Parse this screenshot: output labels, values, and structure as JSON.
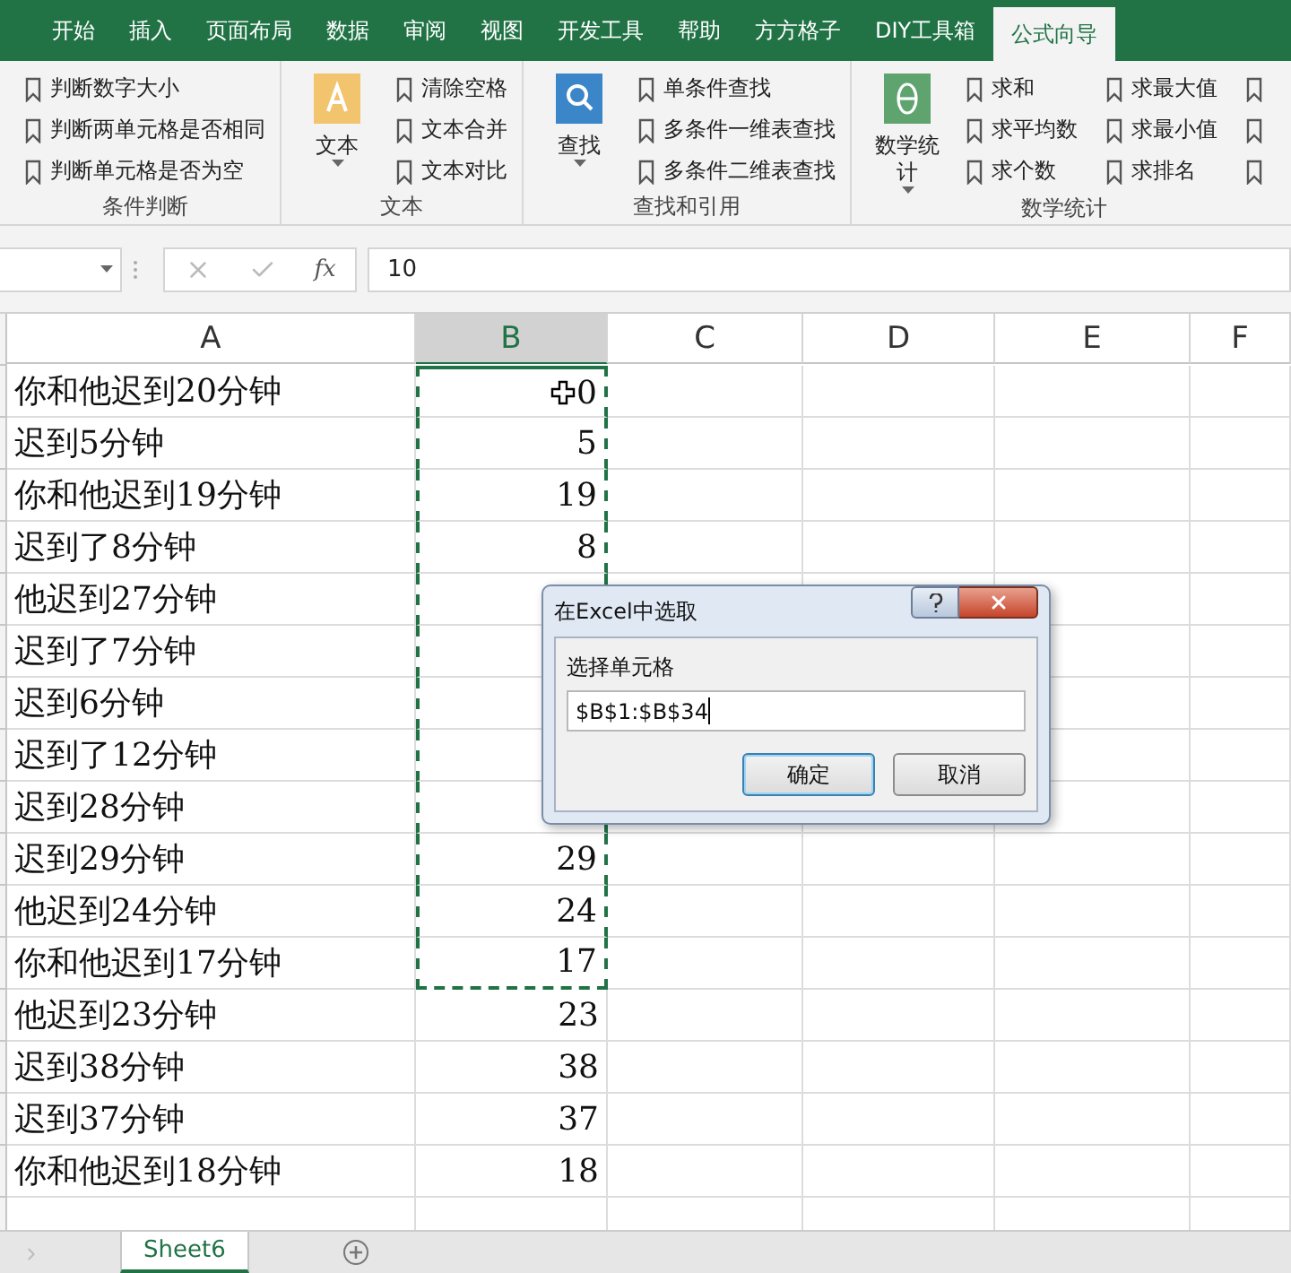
{
  "ribbon_tabs": [
    {
      "label": "开始",
      "selected": false
    },
    {
      "label": "插入",
      "selected": false
    },
    {
      "label": "页面布局",
      "selected": false
    },
    {
      "label": "数据",
      "selected": false
    },
    {
      "label": "审阅",
      "selected": false
    },
    {
      "label": "视图",
      "selected": false
    },
    {
      "label": "开发工具",
      "selected": false
    },
    {
      "label": "帮助",
      "selected": false
    },
    {
      "label": "方方格子",
      "selected": false
    },
    {
      "label": "DIY工具箱",
      "selected": false
    },
    {
      "label": "公式向导",
      "selected": true
    }
  ],
  "ribbon_groups": [
    {
      "label": "条件判断",
      "items": [
        "判断数字大小",
        "判断两单元格是否相同",
        "判断单元格是否为空"
      ]
    },
    {
      "label": "文本",
      "big_button": {
        "label": "文本",
        "kind": "text",
        "dropdown": true
      },
      "items": [
        "清除空格",
        "文本合并",
        "文本对比"
      ]
    },
    {
      "label": "查找和引用",
      "big_button": {
        "label": "查找",
        "kind": "search",
        "dropdown": true
      },
      "items": [
        "单条件查找",
        "多条件一维表查找",
        "多条件二维表查找"
      ]
    },
    {
      "label": "数学统计",
      "big_button": {
        "label": "数学统计",
        "kind": "theta",
        "dropdown": true
      },
      "items": [
        "求和",
        "求平均数",
        "求个数",
        "求最大值",
        "求最小值",
        "求排名"
      ]
    }
  ],
  "formula_bar": {
    "fx": "fx",
    "value": "10"
  },
  "columns": [
    {
      "label": "A",
      "selected": false
    },
    {
      "label": "B",
      "selected": true
    },
    {
      "label": "C",
      "selected": false
    },
    {
      "label": "D",
      "selected": false
    },
    {
      "label": "E",
      "selected": false
    },
    {
      "label": "F",
      "selected": false
    }
  ],
  "rows": [
    {
      "a": "你和他迟到20分钟",
      "b": "0",
      "marked": true
    },
    {
      "a": "迟到5分钟",
      "b": "5",
      "marked": true
    },
    {
      "a": "你和他迟到19分钟",
      "b": "19",
      "marked": true
    },
    {
      "a": "迟到了8分钟",
      "b": "8",
      "marked": true
    },
    {
      "a": "他迟到27分钟",
      "marked": true
    },
    {
      "a": "迟到了7分钟",
      "marked": true
    },
    {
      "a": "迟到6分钟",
      "marked": true
    },
    {
      "a": "迟到了12分钟",
      "marked": true
    },
    {
      "a": "迟到28分钟",
      "marked": true
    },
    {
      "a": "迟到29分钟",
      "b": "29",
      "marked": true
    },
    {
      "a": "他迟到24分钟",
      "b": "24",
      "marked": true
    },
    {
      "a": "你和他迟到17分钟",
      "b": "17",
      "marked": true
    },
    {
      "a": "他迟到23分钟",
      "b": "23",
      "marked": false
    },
    {
      "a": "迟到38分钟",
      "b": "38",
      "marked": false
    },
    {
      "a": "迟到37分钟",
      "b": "37",
      "marked": false
    },
    {
      "a": "你和他迟到18分钟",
      "b": "18",
      "marked": false
    }
  ],
  "dialog": {
    "title": "在Excel中选取",
    "label": "选择单元格",
    "value": "$B$1:$B$34",
    "buttons": [
      {
        "label": "确定",
        "focused": true
      },
      {
        "label": "取消",
        "focused": false
      }
    ]
  },
  "sheet_tabs": [
    {
      "label": "Sheet6",
      "selected": true
    }
  ]
}
